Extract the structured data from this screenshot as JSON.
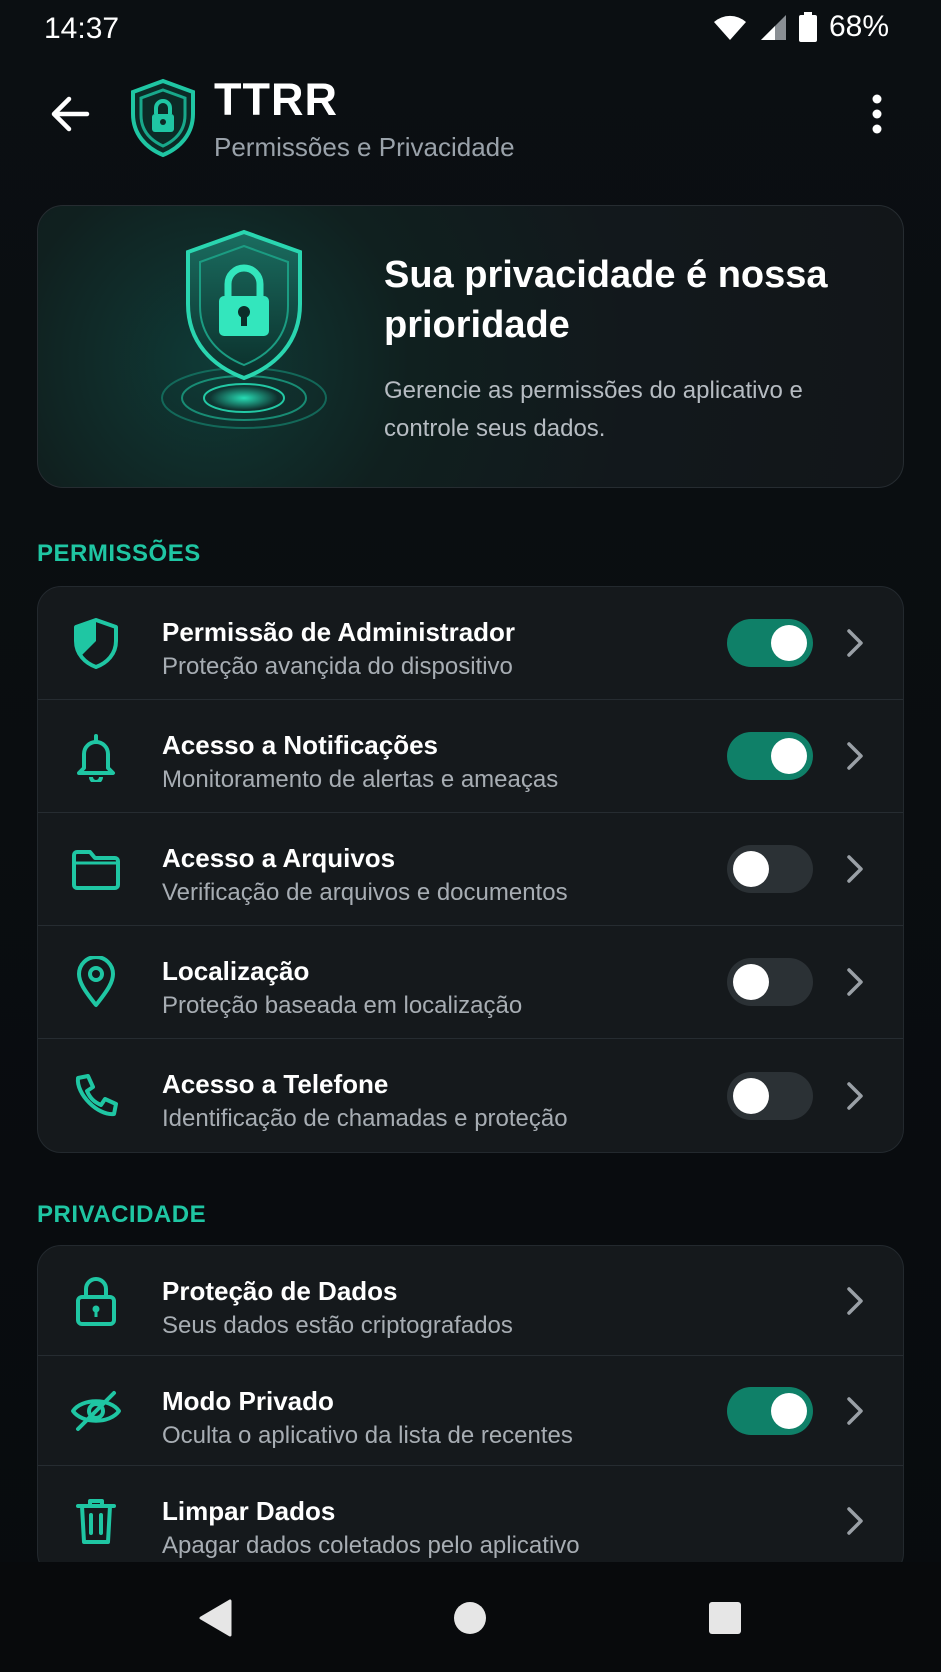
{
  "status": {
    "time": "14:37",
    "battery_pct": "68%",
    "icons": [
      "wifi-icon",
      "signal-icon",
      "battery-icon"
    ]
  },
  "app_bar": {
    "title": "TTRR",
    "subtitle": "Permissões e Privacidade",
    "back_icon": "arrow-left-icon",
    "logo_icon": "shield-lock-icon",
    "more_icon": "more-vert-icon"
  },
  "hero": {
    "title": "Sua privacidade é nossa prioridade",
    "description": "Gerencie as permissões do aplicativo e controle seus dados.",
    "illustration": "shield-lock-illustration"
  },
  "sections": {
    "permissions": {
      "label": "PERMISSÕES",
      "items": [
        {
          "icon": "shield-icon",
          "title": "Permissão de Administrador",
          "subtitle": "Proteção avançida do dispositivo",
          "toggle": true,
          "enabled": true
        },
        {
          "icon": "bell-icon",
          "title": "Acesso a Notificações",
          "subtitle": "Monitoramento de alertas e ameaças",
          "toggle": true,
          "enabled": true
        },
        {
          "icon": "folder-icon",
          "title": "Acesso a Arquivos",
          "subtitle": "Verificação de arquivos e documentos",
          "toggle": true,
          "enabled": false
        },
        {
          "icon": "location-pin-icon",
          "title": "Localização",
          "subtitle": "Proteção baseada em localização",
          "toggle": true,
          "enabled": false
        },
        {
          "icon": "phone-icon",
          "title": "Acesso a Telefone",
          "subtitle": "Identificação de chamadas e proteção",
          "toggle": true,
          "enabled": false
        }
      ]
    },
    "privacy": {
      "label": "PRIVACIDADE",
      "items": [
        {
          "icon": "lock-icon",
          "title": "Proteção de Dados",
          "subtitle": "Seus dados estão criptografados",
          "toggle": false
        },
        {
          "icon": "eye-off-icon",
          "title": "Modo Privado",
          "subtitle": "Oculta o aplicativo da lista de recentes",
          "toggle": true,
          "enabled": true
        },
        {
          "icon": "trash-icon",
          "title": "Limpar Dados",
          "subtitle": "Apagar dados coletados pelo aplicativo",
          "toggle": false
        }
      ]
    }
  },
  "nav": {
    "back_icon": "nav-back-icon",
    "home_icon": "nav-home-icon",
    "recents_icon": "nav-recents-icon"
  },
  "colors": {
    "accent": "#1fc6a3",
    "toggle_on": "#0f8068",
    "toggle_off": "#2b3135",
    "card": "#15191c",
    "background": "#090c0f"
  }
}
